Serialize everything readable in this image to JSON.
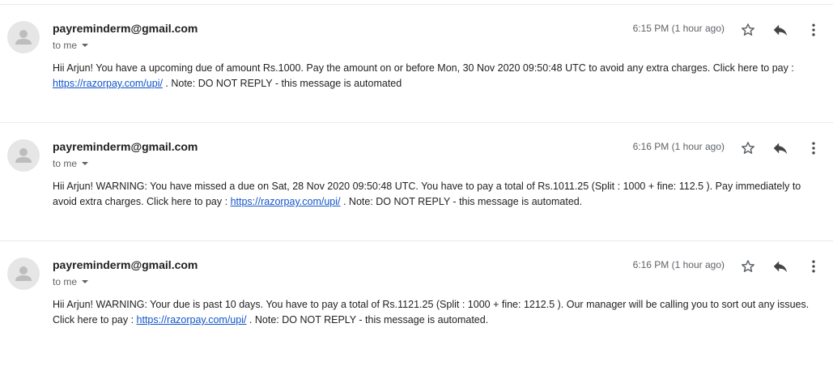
{
  "emails": [
    {
      "sender": "payreminderm@gmail.com",
      "recipient_label": "to me",
      "time": "6:15 PM (1 hour ago)",
      "body_before": "Hii Arjun! You have a upcoming due of amount Rs.1000. Pay the amount on or before Mon, 30 Nov 2020 09:50:48 UTC to avoid any extra charges. Click here to pay : ",
      "link": "https://razorpay.com/upi/",
      "body_after": " . Note: DO NOT REPLY - this message is automated"
    },
    {
      "sender": "payreminderm@gmail.com",
      "recipient_label": "to me",
      "time": "6:16 PM (1 hour ago)",
      "body_before": "Hii Arjun! WARNING: You have missed a due on Sat, 28 Nov 2020 09:50:48 UTC. You have to pay a total of Rs.1011.25 (Split : 1000 + fine: 112.5 ). Pay immediately to avoid extra charges. Click here to pay : ",
      "link": "https://razorpay.com/upi/",
      "body_after": " . Note: DO NOT REPLY - this message is automated."
    },
    {
      "sender": "payreminderm@gmail.com",
      "recipient_label": "to me",
      "time": "6:16 PM (1 hour ago)",
      "body_before": "Hii Arjun! WARNING: Your due is past 10 days. You have to pay a total of Rs.1121.25 (Split : 1000 + fine: 1212.5 ). Our manager will be calling you to sort out any issues. Click here to pay : ",
      "link": "https://razorpay.com/upi/",
      "body_after": " . Note: DO NOT REPLY - this message is automated."
    }
  ],
  "icons": {
    "avatar": "default-avatar-icon",
    "star": "star-outline-icon",
    "reply": "reply-arrow-icon",
    "more": "more-vert-icon",
    "caret": "caret-down-icon"
  },
  "colors": {
    "link": "#1155cc",
    "sender": "#202124",
    "muted": "#5f6368",
    "divider": "#eaeaea"
  }
}
